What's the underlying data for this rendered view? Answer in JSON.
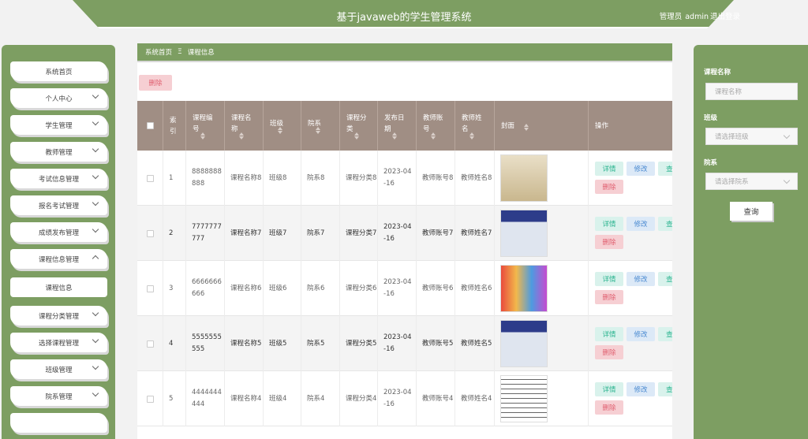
{
  "header": {
    "title": "基于javaweb的学生管理系统",
    "user_role": "管理员",
    "user_name": "admin",
    "logout_label": "退出登录"
  },
  "sidebar": {
    "items": [
      {
        "label": "系统首页",
        "has_chevron": false
      },
      {
        "label": "个人中心",
        "has_chevron": true
      },
      {
        "label": "学生管理",
        "has_chevron": true
      },
      {
        "label": "教师管理",
        "has_chevron": true
      },
      {
        "label": "考试信息管理",
        "has_chevron": true
      },
      {
        "label": "报名考试管理",
        "has_chevron": true
      },
      {
        "label": "成绩发布管理",
        "has_chevron": true
      },
      {
        "label": "课程信息管理",
        "has_chevron": true,
        "expanded": true
      },
      {
        "label": "课程信息",
        "sub": true
      },
      {
        "label": "课程分类管理",
        "has_chevron": true
      },
      {
        "label": "选择课程管理",
        "has_chevron": true
      },
      {
        "label": "班级管理",
        "has_chevron": true
      },
      {
        "label": "院系管理",
        "has_chevron": true
      }
    ]
  },
  "breadcrumb": {
    "home": "系统首页",
    "separator": "Ξ",
    "current": "课程信息"
  },
  "toolbar": {
    "delete_label": "删除"
  },
  "table": {
    "headers": {
      "index": "索引",
      "code": "课程编号",
      "name": "课程名称",
      "class": "班级",
      "dept": "院系",
      "category": "课程分类",
      "date": "发布日期",
      "teacher_no": "教师账号",
      "teacher_name": "教师姓名",
      "cover": "封面",
      "ops": "操作"
    },
    "rows": [
      {
        "index": "1",
        "code": "8888888888",
        "name": "课程名称8",
        "class": "班级8",
        "dept": "院系8",
        "category": "课程分类8",
        "date": "2023-04-16",
        "teacher_no": "教师账号8",
        "teacher_name": "教师姓名8"
      },
      {
        "index": "2",
        "code": "7777777777",
        "name": "课程名称7",
        "class": "班级7",
        "dept": "院系7",
        "category": "课程分类7",
        "date": "2023-04-16",
        "teacher_no": "教师账号7",
        "teacher_name": "教师姓名7"
      },
      {
        "index": "3",
        "code": "6666666666",
        "name": "课程名称6",
        "class": "班级6",
        "dept": "院系6",
        "category": "课程分类6",
        "date": "2023-04-16",
        "teacher_no": "教师账号6",
        "teacher_name": "教师姓名6"
      },
      {
        "index": "4",
        "code": "5555555555",
        "name": "课程名称5",
        "class": "班级5",
        "dept": "院系5",
        "category": "课程分类5",
        "date": "2023-04-16",
        "teacher_no": "教师账号5",
        "teacher_name": "教师姓名5"
      },
      {
        "index": "5",
        "code": "4444444444",
        "name": "课程名称4",
        "class": "班级4",
        "dept": "院系4",
        "category": "课程分类4",
        "date": "2023-04-16",
        "teacher_no": "教师账号4",
        "teacher_name": "教师姓名4"
      }
    ],
    "ops": {
      "detail": "详情",
      "edit": "修改",
      "view": "查",
      "delete": "删除"
    }
  },
  "search": {
    "course_name_label": "课程名称",
    "course_name_placeholder": "课程名称",
    "class_label": "班级",
    "class_placeholder": "请选择班级",
    "dept_label": "院系",
    "dept_placeholder": "请选择院系",
    "query_label": "查询"
  },
  "colors": {
    "primary": "#7d9e62",
    "table_header": "#a08e84",
    "danger_bg": "#f6cfd3",
    "success_bg": "#d9f2ec",
    "info_bg": "#dce9f7"
  }
}
